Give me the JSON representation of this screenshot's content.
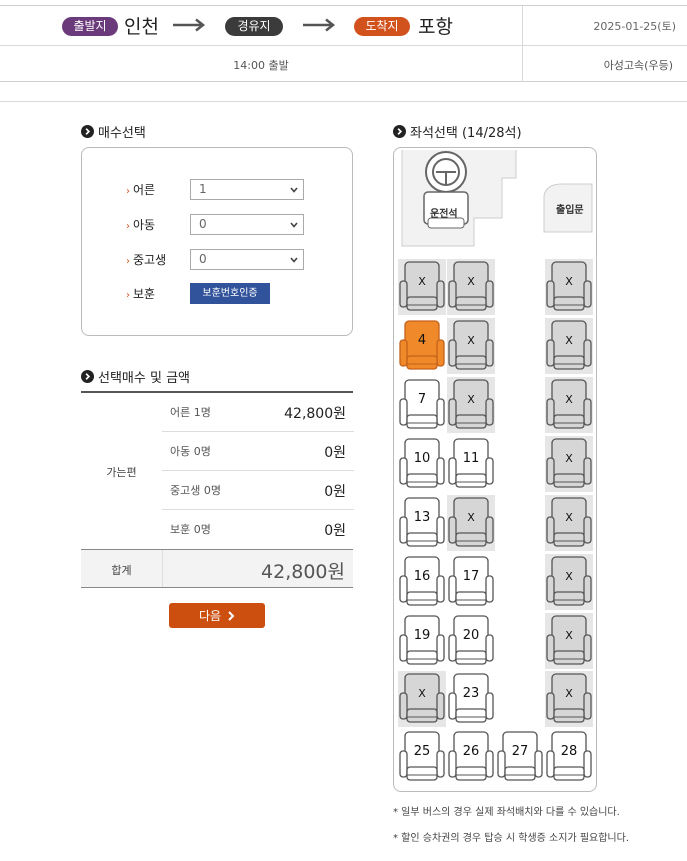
{
  "route": {
    "departure_badge": "출발지",
    "departure_city": "인천",
    "via_badge": "경유지",
    "arrival_badge": "도착지",
    "arrival_city": "포항",
    "date": "2025-01-25(토)",
    "departure_time": "14:00 출발",
    "bus_company": "아성고속(우등)"
  },
  "count_section": {
    "title": "매수선택",
    "rows": [
      {
        "label": "어른",
        "value": "1"
      },
      {
        "label": "아동",
        "value": "0"
      },
      {
        "label": "중고생",
        "value": "0"
      }
    ],
    "veteran_label": "보훈",
    "veteran_button": "보훈번호인증"
  },
  "price_section": {
    "title": "선택매수 및 금액",
    "side_label": "가는편",
    "rows": [
      {
        "label": "어른 1명",
        "value": "42,800원"
      },
      {
        "label": "아동 0명",
        "value": "0원"
      },
      {
        "label": "중고생 0명",
        "value": "0원"
      },
      {
        "label": "보훈 0명",
        "value": "0원"
      }
    ],
    "total_label": "합계",
    "total_value": "42,800원"
  },
  "next_button": "다음",
  "seat_section": {
    "title": "좌석선택 (14/28석)",
    "driver_label": "운전석",
    "door_label": "출입문",
    "seats": [
      {
        "label": "X",
        "status": "taken"
      },
      {
        "label": "X",
        "status": "taken"
      },
      {
        "label": "X",
        "status": "taken"
      },
      {
        "label": "4",
        "status": "selected"
      },
      {
        "label": "X",
        "status": "taken"
      },
      {
        "label": "X",
        "status": "taken"
      },
      {
        "label": "7",
        "status": "available"
      },
      {
        "label": "X",
        "status": "taken"
      },
      {
        "label": "X",
        "status": "taken"
      },
      {
        "label": "10",
        "status": "available"
      },
      {
        "label": "11",
        "status": "available"
      },
      {
        "label": "X",
        "status": "taken"
      },
      {
        "label": "13",
        "status": "available"
      },
      {
        "label": "X",
        "status": "taken"
      },
      {
        "label": "X",
        "status": "taken"
      },
      {
        "label": "16",
        "status": "available"
      },
      {
        "label": "17",
        "status": "available"
      },
      {
        "label": "X",
        "status": "taken"
      },
      {
        "label": "19",
        "status": "available"
      },
      {
        "label": "20",
        "status": "available"
      },
      {
        "label": "X",
        "status": "taken"
      },
      {
        "label": "X",
        "status": "taken"
      },
      {
        "label": "23",
        "status": "available"
      },
      {
        "label": "X",
        "status": "taken"
      },
      {
        "label": "25",
        "status": "available"
      },
      {
        "label": "26",
        "status": "available"
      },
      {
        "label": "27",
        "status": "available"
      },
      {
        "label": "28",
        "status": "available"
      }
    ]
  },
  "notes": [
    "* 일부 버스의 경우 실제 좌석배치와 다를 수 있습니다.",
    "* 할인 승차권의 경우 탑승 시 학생증 소지가 필요합니다."
  ],
  "colors": {
    "departure": "#6b3a7b",
    "via": "#3b3b3b",
    "arrival": "#d2521e",
    "selected_seat": "#f0892a",
    "taken_seat": "#d6d6d6",
    "next_button": "#cc4f10",
    "veteran_button": "#31539b"
  }
}
